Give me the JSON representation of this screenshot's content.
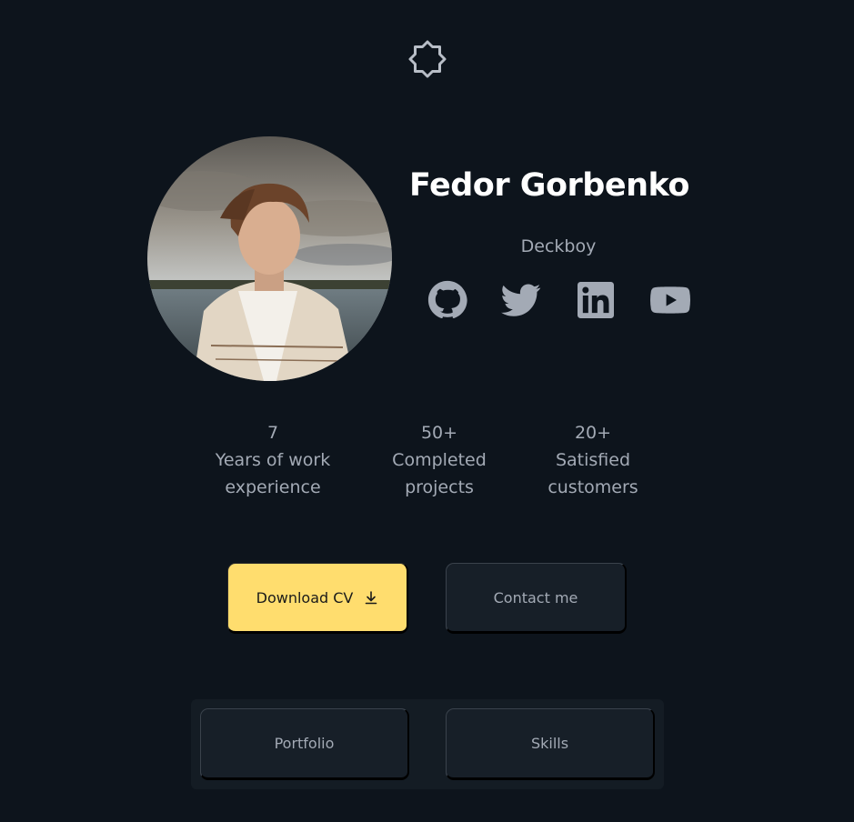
{
  "theme_toggle": {
    "icon": "moon-sun-icon"
  },
  "profile": {
    "name": "Fedor Gorbenko",
    "role": "Deckboy",
    "avatar_alt": "photo"
  },
  "socials": [
    {
      "icon": "github-icon"
    },
    {
      "icon": "twitter-icon"
    },
    {
      "icon": "linkedin-icon"
    },
    {
      "icon": "youtube-icon"
    }
  ],
  "stats": [
    {
      "value": "7",
      "label_line1": "Years of work",
      "label_line2": "experience"
    },
    {
      "value": "50+",
      "label_line1": "Completed",
      "label_line2": "projects"
    },
    {
      "value": "20+",
      "label_line1": "Satisfied",
      "label_line2": "customers"
    }
  ],
  "actions": {
    "download_label": "Download CV",
    "download_icon": "download-icon",
    "contact_label": "Contact me"
  },
  "tabs": [
    {
      "label": "Portfolio"
    },
    {
      "label": "Skills"
    }
  ],
  "colors": {
    "background": "#0d141c",
    "accent": "#ffdd6e",
    "text": "#a3aab5",
    "heading": "#ffffff",
    "button_dark": "#171f28"
  }
}
